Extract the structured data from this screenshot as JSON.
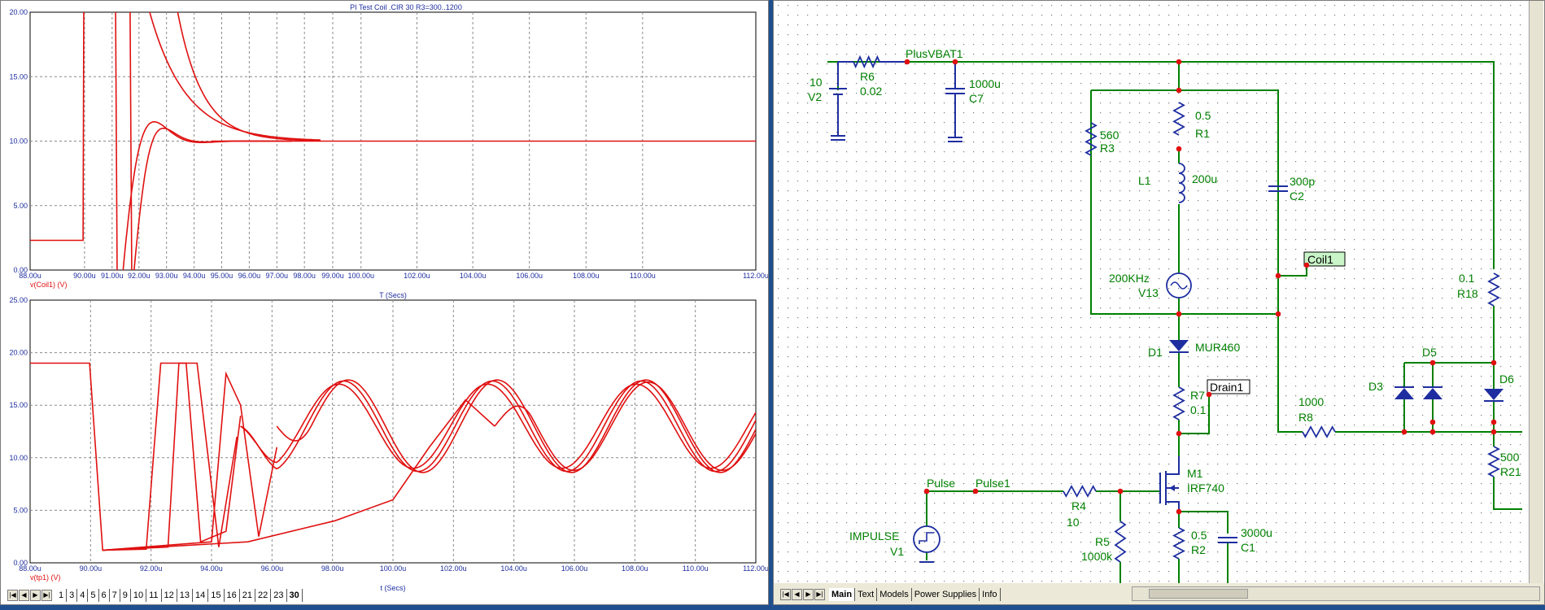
{
  "plot_window": {
    "title": "PI Test Coil .CIR 30 R3=300..1200",
    "top_plot": {
      "y_ticks": [
        "20.00",
        "15.00",
        "10.00",
        "5.00",
        "0.00"
      ],
      "x_ticks": [
        "88.00u",
        "90.00u",
        "91.00u",
        "92.00u",
        "93.00u",
        "94.00u",
        "95.00u",
        "96.00u",
        "97.00u",
        "98.00u",
        "99.00u",
        "100.00u",
        "102.00u",
        "104.00u",
        "106.00u",
        "108.00u",
        "110.00u",
        "112.00u"
      ],
      "trace_label": "v(Coil1) (V)",
      "x_label": "T (Secs)"
    },
    "bottom_plot": {
      "y_ticks": [
        "25.00",
        "20.00",
        "15.00",
        "10.00",
        "5.00",
        "0.00"
      ],
      "x_ticks": [
        "88.00u",
        "90.00u",
        "92.00u",
        "94.00u",
        "96.00u",
        "98.00u",
        "100.00u",
        "102.00u",
        "104.00u",
        "106.00u",
        "108.00u",
        "110.00u",
        "112.00u"
      ],
      "trace_label": "v(tp1) (V)",
      "x_label": "t (Secs)"
    },
    "page_tabs": [
      "1",
      "3",
      "4",
      "5",
      "6",
      "7",
      "9",
      "10",
      "11",
      "12",
      "13",
      "14",
      "15",
      "16",
      "21",
      "22",
      "23",
      "30"
    ],
    "active_page_tab": "30"
  },
  "schematic": {
    "tabs": [
      "Main",
      "Text",
      "Models",
      "Power Supplies",
      "Info"
    ],
    "active_tab": "Main",
    "labels": {
      "v2_val": "10",
      "v2": "V2",
      "r6": "R6",
      "r6_val": "0.02",
      "plusvbat": "PlusVBAT1",
      "c7_val": "1000u",
      "c7": "C7",
      "r3_val": "560",
      "r3": "R3",
      "r1_val": "0.5",
      "r1": "R1",
      "l1": "L1",
      "l1_val": "200u",
      "c2_val": "300p",
      "c2": "C2",
      "coil1": "Coil1",
      "v13_val": "200KHz",
      "v13": "V13",
      "r18_val": "0.1",
      "r18": "R18",
      "d1": "D1",
      "d1_val": "MUR460",
      "d5": "D5",
      "d3": "D3",
      "d6": "D6",
      "r7": "R7",
      "r7_val": "0.1",
      "drain1": "Drain1",
      "r8_val": "1000",
      "r8": "R8",
      "r21_val": "500",
      "r21": "R21",
      "pulse": "Pulse",
      "pulse1": "Pulse1",
      "m1": "M1",
      "m1_val": "IRF740",
      "r4": "R4",
      "r4_val": "10",
      "impulse": "IMPULSE",
      "v1": "V1",
      "r5": "R5",
      "r5_val": "1000k",
      "r2_val": "0.5",
      "r2": "R2",
      "c1_val": "3000u",
      "c1": "C1"
    }
  },
  "colors": {
    "trace": "#e01010",
    "wire": "#008000",
    "component": "#1e2ea0",
    "label": "#008000",
    "node": "#e01010",
    "grid": "#8a8a8a"
  }
}
